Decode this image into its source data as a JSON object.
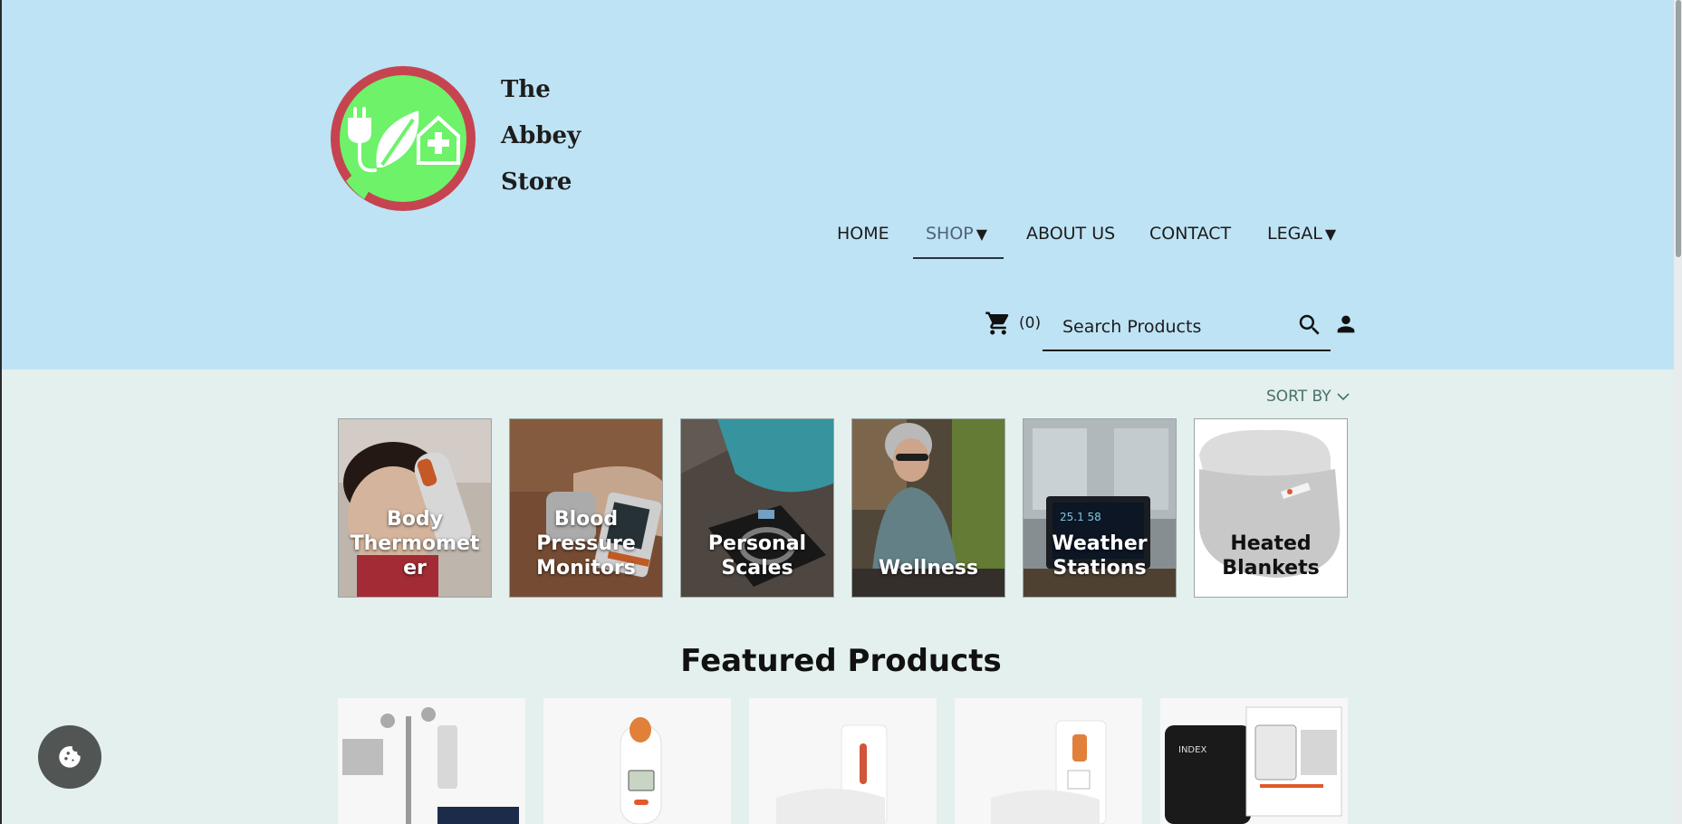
{
  "brand": {
    "line1": "The",
    "line2": "Abbey",
    "line3": "Store",
    "logo_colors": {
      "ring": "#c64450",
      "fill": "#6df26a",
      "icon": "#ffffff"
    }
  },
  "nav": {
    "home": "HOME",
    "shop": "SHOP",
    "about": "ABOUT US",
    "contact": "CONTACT",
    "legal": "LEGAL",
    "caret": "▼",
    "active": "shop"
  },
  "header_tools": {
    "cart_count": "(0)",
    "search_placeholder": "Search Products"
  },
  "sort": {
    "label": "SORT BY"
  },
  "categories": [
    {
      "label": "Body Thermometer",
      "line1": "Body",
      "line2": "Thermomet",
      "line3": "er"
    },
    {
      "label": "Blood Pressure Monitors",
      "line1": "Blood",
      "line2": "Pressure",
      "line3": "Monitors"
    },
    {
      "label": "Personal Scales",
      "line1": "Personal",
      "line2": "Scales"
    },
    {
      "label": "Wellness",
      "line1": "Wellness"
    },
    {
      "label": "Weather Stations",
      "line1": "Weather",
      "line2": "Stations"
    },
    {
      "label": "Heated Blankets",
      "line1": "Heated",
      "line2": "Blankets"
    }
  ],
  "featured": {
    "title": "Featured Products"
  },
  "colors": {
    "header_bg": "#bee3f4",
    "page_bg": "#e3f0ee",
    "sort_text": "#49706a",
    "cookie_bg": "#515553"
  }
}
